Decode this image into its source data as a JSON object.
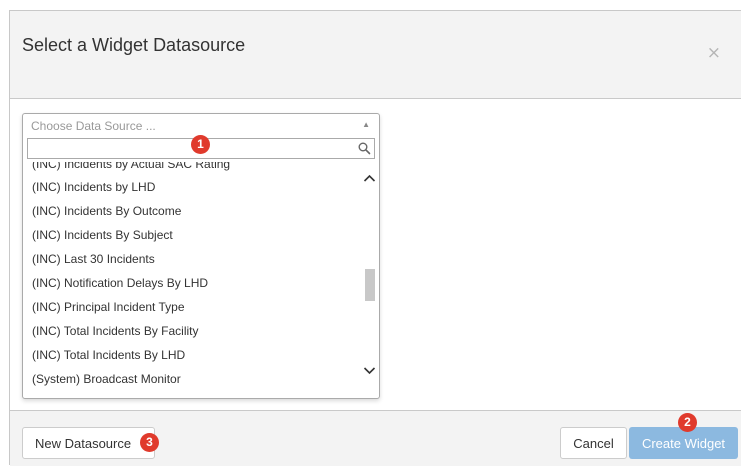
{
  "dialog": {
    "title": "Select a Widget Datasource",
    "close_symbol": "×"
  },
  "select": {
    "placeholder": "Choose Data Source ...",
    "arrow_symbol": "▲",
    "search_value": "",
    "options": [
      "(INC) Incidents by Actual SAC Rating",
      "(INC) Incidents by LHD",
      "(INC) Incidents By Outcome",
      "(INC) Incidents By Subject",
      "(INC) Last 30 Incidents",
      "(INC) Notification Delays By LHD",
      "(INC) Principal Incident Type",
      "(INC) Total Incidents By Facility",
      "(INC) Total Incidents By LHD",
      "(System) Broadcast Monitor"
    ]
  },
  "badges": {
    "one": "1",
    "two": "2",
    "three": "3"
  },
  "footer": {
    "new_datasource_label": "New Datasource",
    "cancel_label": "Cancel",
    "create_widget_label": "Create Widget"
  },
  "colors": {
    "badge": "#e03a2c",
    "primary_disabled": "#8cb9e0",
    "header_bg": "#f3f3f3"
  },
  "icons": {
    "search": "search-icon",
    "close": "close-icon",
    "scroll_up": "chevron-up-icon",
    "scroll_down": "chevron-down-icon"
  }
}
